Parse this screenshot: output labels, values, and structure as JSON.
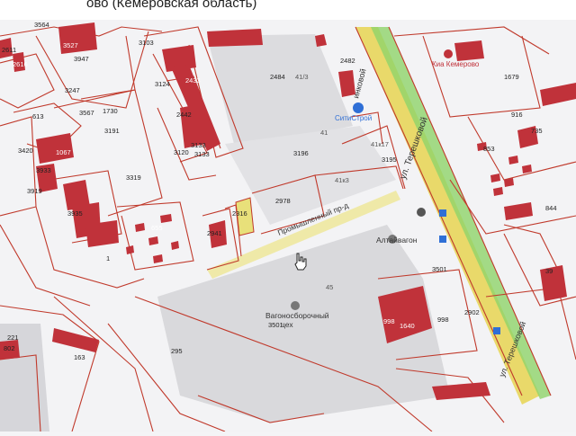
{
  "header": {
    "title": "ово (Кемеровская область)"
  },
  "colors": {
    "parcel_line": "#c0392b",
    "building": "#c0323a",
    "highlight": "#e8e07a",
    "road_yellow": "#e9d96a",
    "road_green": "#8fd36a",
    "poi_blue": "#2f6fd6"
  },
  "streets": {
    "tereshkovoy_main": "ул. Терешковой",
    "tereshkovoy_lower": "ул. Терешковой",
    "promyshlenny": "Промышленный пр-д",
    "linkovoy": "инковой"
  },
  "poi": {
    "citystroy": "СитиСтрой",
    "kia": "Киа Кемерово",
    "altaivagon": "Алтайвагон",
    "vagonosborochny_line1": "Вагоносборочный",
    "vagonosborochny_line2": "цех"
  },
  "parcels": {
    "p3947": "3947",
    "p3527": "3527",
    "p3103": "3103",
    "p3247": "3247",
    "p613": "613",
    "p3567": "3567",
    "p1730": "1730",
    "p3191": "3191",
    "p3420": "3420",
    "p1067": "1067",
    "p3933": "3933",
    "p3319": "3319",
    "p3919": "3919",
    "p3935": "3935",
    "p655": "655",
    "p1": "1",
    "p3120": "3120",
    "p3133": "3133",
    "p2484": "2484",
    "p413": "41/3",
    "p2482": "2482",
    "p3196": "3196",
    "p2978": "2978",
    "p2316": "2316",
    "p2941": "2941",
    "p41": "41",
    "p1679": "1679",
    "p916": "916",
    "p853": "853",
    "p735": "735",
    "p844": "844",
    "p3501a": "3501",
    "p3501b": "3501",
    "p45": "45",
    "p998a": "998",
    "p998b": "998",
    "p2902": "2902",
    "p163": "163",
    "p295": "295",
    "p802": "802",
    "p221": "221",
    "p39": "39",
    "p3195": "3195",
    "p4117": "41к17",
    "p413b": "41к3",
    "p3124": "3124",
    "p2433": "2433",
    "p2442": "2442",
    "p1640": "1640",
    "p2611": "2611",
    "p2616": "2616",
    "p3564": "3564",
    "p3133b": "3133"
  }
}
